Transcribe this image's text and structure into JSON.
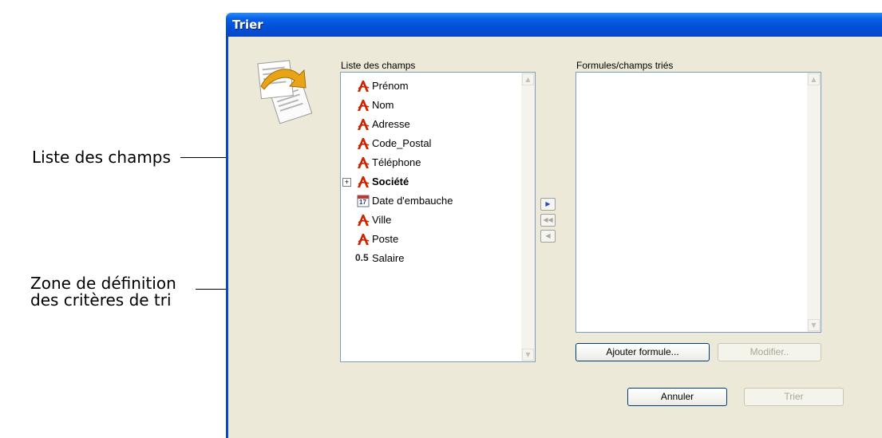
{
  "callouts": {
    "field_list": "Liste des champs",
    "criteria_line1": "Zone de définition",
    "criteria_line2": "des critères de tri"
  },
  "dialog": {
    "title": "Trier",
    "field_list_label": "Liste des champs",
    "sorted_label": "Formules/champs triés",
    "fields": [
      {
        "label": "Prénom",
        "icon": "text-field-icon"
      },
      {
        "label": "Nom",
        "icon": "text-field-icon"
      },
      {
        "label": "Adresse",
        "icon": "text-field-icon"
      },
      {
        "label": "Code_Postal",
        "icon": "text-field-icon"
      },
      {
        "label": "Téléphone",
        "icon": "text-field-icon"
      },
      {
        "label": "Société",
        "icon": "text-field-icon",
        "bold": true,
        "expandable": true
      },
      {
        "label": "Date d'embauche",
        "icon": "date-field-icon",
        "date_glyph": "17"
      },
      {
        "label": "Ville",
        "icon": "text-field-icon"
      },
      {
        "label": "Poste",
        "icon": "text-field-icon"
      },
      {
        "label": "Salaire",
        "icon": "numeric-field-icon",
        "num_glyph": "0.5"
      }
    ],
    "sorted_items": [],
    "buttons": {
      "add_formula": "Ajouter formule...",
      "modify": "Modifier..",
      "cancel": "Annuler",
      "sort": "Trier"
    },
    "colors": {
      "titlebar": "#0a5fe6",
      "dialog_bg": "#ece9d8",
      "text_icon": "#cc2200"
    }
  }
}
